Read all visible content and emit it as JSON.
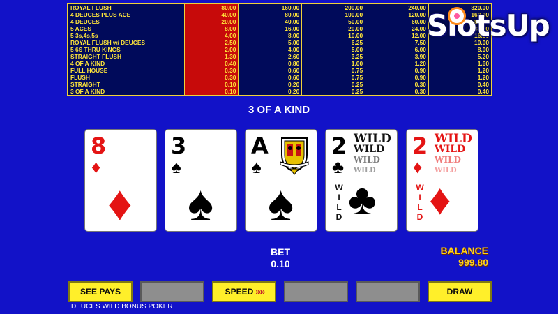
{
  "paytable": {
    "rows": [
      {
        "hand": "ROYAL FLUSH",
        "values": [
          "80.00",
          "160.00",
          "200.00",
          "240.00",
          "320.00"
        ]
      },
      {
        "hand": "4 DEUCES PLUS ACE",
        "values": [
          "40.00",
          "80.00",
          "100.00",
          "120.00",
          "160.00"
        ]
      },
      {
        "hand": "4 DEUCES",
        "values": [
          "20.00",
          "40.00",
          "50.00",
          "60.00",
          "80.00"
        ]
      },
      {
        "hand": "5 ACES",
        "values": [
          "8.00",
          "16.00",
          "20.00",
          "24.00",
          "32.00"
        ]
      },
      {
        "hand": "5 3s,4s,5s",
        "values": [
          "4.00",
          "8.00",
          "10.00",
          "12.00",
          "16.00"
        ]
      },
      {
        "hand": "ROYAL FLUSH w/ DEUCES",
        "values": [
          "2.50",
          "5.00",
          "6.25",
          "7.50",
          "10.00"
        ]
      },
      {
        "hand": "5 6S THRU KINGS",
        "values": [
          "2.00",
          "4.00",
          "5.00",
          "6.00",
          "8.00"
        ]
      },
      {
        "hand": "STRAIGHT FLUSH",
        "values": [
          "1.30",
          "2.60",
          "3.25",
          "3.90",
          "5.20"
        ]
      },
      {
        "hand": "4 OF A KIND",
        "values": [
          "0.40",
          "0.80",
          "1.00",
          "1.20",
          "1.60"
        ]
      },
      {
        "hand": "FULL HOUSE",
        "values": [
          "0.30",
          "0.60",
          "0.75",
          "0.90",
          "1.20"
        ]
      },
      {
        "hand": "FLUSH",
        "values": [
          "0.30",
          "0.60",
          "0.75",
          "0.90",
          "1.20"
        ]
      },
      {
        "hand": "STRAIGHT",
        "values": [
          "0.10",
          "0.20",
          "0.25",
          "0.30",
          "0.40"
        ]
      },
      {
        "hand": "3 OF A KIND",
        "values": [
          "0.10",
          "0.20",
          "0.25",
          "0.30",
          "0.40"
        ]
      }
    ],
    "selected_column": 0,
    "colors": {
      "border": "#f0d23a",
      "text": "#ffe63a",
      "selected": "#c70a0a"
    }
  },
  "logo": {
    "text": "SlotsUp"
  },
  "result": {
    "text": "3 OF A KIND"
  },
  "cards": [
    {
      "rank": "8",
      "suit": "♦",
      "color": "red"
    },
    {
      "rank": "3",
      "suit": "♠",
      "color": "black"
    },
    {
      "rank": "A",
      "suit": "♠",
      "color": "black"
    },
    {
      "rank": "2",
      "suit": "♣",
      "color": "black",
      "wild": [
        "WILD",
        "WILD",
        "WILD",
        "WILD"
      ],
      "wild_vertical": [
        "W",
        "I",
        "L",
        "D"
      ]
    },
    {
      "rank": "2",
      "suit": "♦",
      "color": "red",
      "wild": [
        "WILD",
        "WILD",
        "WILD",
        "WILD"
      ],
      "wild_vertical": [
        "W",
        "I",
        "L",
        "D"
      ]
    }
  ],
  "bet": {
    "label": "BET",
    "value": "0.10"
  },
  "balance": {
    "label": "BALANCE",
    "value": "999.80"
  },
  "buttons": {
    "see_pays": "SEE PAYS",
    "speed": "SPEED",
    "speed_arrows": "»»»",
    "draw": "DRAW"
  },
  "game_name": "DEUCES WILD BONUS POKER",
  "colors": {
    "background": "#1212c8",
    "button_yellow": "#ffef2a",
    "button_gray": "#8e8e8e",
    "balance": "#ffd21a"
  }
}
